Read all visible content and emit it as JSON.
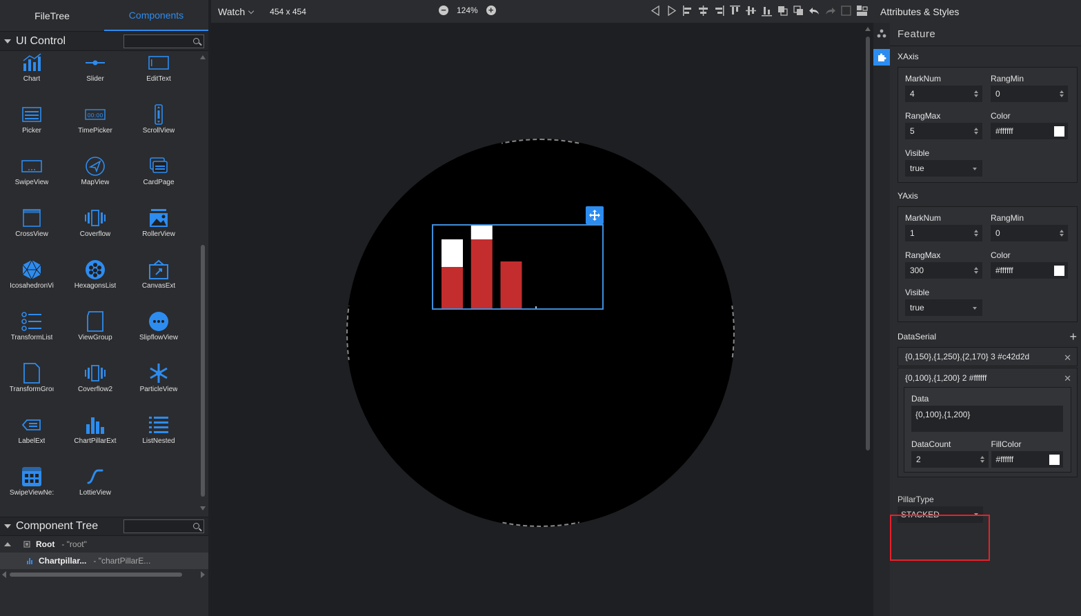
{
  "left": {
    "tabs": [
      "FileTree",
      "Components"
    ],
    "ui_control_title": "UI Control",
    "components": [
      {
        "label": "Chart",
        "icon": "chart-icon"
      },
      {
        "label": "Slider",
        "icon": "slider-icon"
      },
      {
        "label": "EditText",
        "icon": "edittext-icon"
      },
      {
        "label": "Picker",
        "icon": "picker-icon"
      },
      {
        "label": "TimePicker",
        "icon": "timepicker-icon"
      },
      {
        "label": "ScrollView",
        "icon": "scrollview-icon"
      },
      {
        "label": "SwipeView",
        "icon": "swipeview-icon"
      },
      {
        "label": "MapView",
        "icon": "mapview-icon"
      },
      {
        "label": "CardPage",
        "icon": "cardpage-icon"
      },
      {
        "label": "CrossView",
        "icon": "crossview-icon"
      },
      {
        "label": "Coverflow",
        "icon": "coverflow-icon"
      },
      {
        "label": "RollerView",
        "icon": "rollerview-icon"
      },
      {
        "label": "IcosahedronVi",
        "icon": "icosahedron-icon"
      },
      {
        "label": "HexagonsList",
        "icon": "hexagons-icon"
      },
      {
        "label": "CanvasExt",
        "icon": "canvasext-icon"
      },
      {
        "label": "TransformList",
        "icon": "transformlist-icon"
      },
      {
        "label": "ViewGroup",
        "icon": "viewgroup-icon"
      },
      {
        "label": "SlipflowView",
        "icon": "slipflow-icon"
      },
      {
        "label": "TransformGroı",
        "icon": "transformgroup-icon"
      },
      {
        "label": "Coverflow2",
        "icon": "coverflow2-icon"
      },
      {
        "label": "ParticleView",
        "icon": "particleview-icon"
      },
      {
        "label": "LabelExt",
        "icon": "labelext-icon"
      },
      {
        "label": "ChartPillarExt",
        "icon": "chartpillar-icon"
      },
      {
        "label": "ListNested",
        "icon": "listnested-icon"
      },
      {
        "label": "SwipeViewNe:",
        "icon": "swipeviewnested-icon"
      },
      {
        "label": "LottieView",
        "icon": "lottie-icon"
      }
    ],
    "tree_title": "Component Tree",
    "tree": [
      {
        "name": "Root",
        "id": "- \"root\""
      },
      {
        "name": "Chartpillar...",
        "id": "- \"chartPillarE..."
      }
    ]
  },
  "toolbar": {
    "device": "Watch",
    "size": "454 x 454",
    "zoom": "124%"
  },
  "right": {
    "title": "Attributes & Styles",
    "feature": "Feature",
    "xaxis": {
      "title": "XAxis",
      "marknum_label": "MarkNum",
      "marknum": "4",
      "rangmin_label": "RangMin",
      "rangmin": "0",
      "rangmax_label": "RangMax",
      "rangmax": "5",
      "color_label": "Color",
      "color": "#ffffff",
      "visible_label": "Visible",
      "visible": "true"
    },
    "yaxis": {
      "title": "YAxis",
      "marknum_label": "MarkNum",
      "marknum": "1",
      "rangmin_label": "RangMin",
      "rangmin": "0",
      "rangmax_label": "RangMax",
      "rangmax": "300",
      "color_label": "Color",
      "color": "#ffffff",
      "visible_label": "Visible",
      "visible": "true"
    },
    "dataserial": {
      "title": "DataSerial",
      "items": [
        "{0,150},{1,250},{2,170} 3 #c42d2d",
        "{0,100},{1,200} 2 #ffffff"
      ],
      "data_label": "Data",
      "data": "{0,100},{1,200}",
      "datacount_label": "DataCount",
      "datacount": "2",
      "fillcolor_label": "FillColor",
      "fillcolor": "#ffffff"
    },
    "pillartype_label": "PillarType",
    "pillartype": "STACKED"
  },
  "chart_data": {
    "type": "bar",
    "stacked": true,
    "x": [
      0,
      1,
      2
    ],
    "series": [
      {
        "values": [
          150,
          250,
          170
        ],
        "color": "#c42d2d"
      },
      {
        "values": [
          100,
          200
        ],
        "color": "#ffffff"
      }
    ],
    "xlim": [
      0,
      5
    ],
    "ylim": [
      0,
      300
    ],
    "x_marks": 4,
    "y_marks": 1
  }
}
